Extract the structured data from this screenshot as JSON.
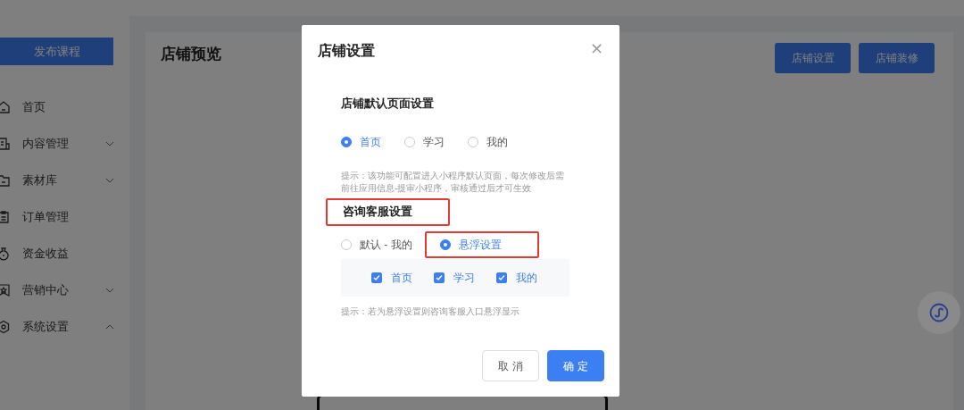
{
  "sidebar": {
    "publish_button": "发布课程",
    "items": [
      {
        "label": "首页",
        "expandable": false
      },
      {
        "label": "内容管理",
        "expandable": true,
        "expanded": false
      },
      {
        "label": "素材库",
        "expandable": true,
        "expanded": false
      },
      {
        "label": "订单管理",
        "expandable": false
      },
      {
        "label": "资金收益",
        "expandable": false
      },
      {
        "label": "营销中心",
        "expandable": true,
        "expanded": false
      },
      {
        "label": "系统设置",
        "expandable": true,
        "expanded": true
      }
    ]
  },
  "main": {
    "title": "店铺预览",
    "buttons": [
      "店铺设置",
      "店铺装修"
    ]
  },
  "modal": {
    "title": "店铺设置",
    "close": "×",
    "default_page": {
      "heading": "店铺默认页面设置",
      "options": [
        {
          "label": "首页",
          "selected": true
        },
        {
          "label": "学习",
          "selected": false
        },
        {
          "label": "我的",
          "selected": false
        }
      ],
      "hint": "提示：该功能可配置进入小程序默认页面，每次修改后需前往应用信息-提审小程序，审核通过后才可生效"
    },
    "consult": {
      "heading": "咨询客服设置",
      "heading_highlighted": true,
      "options": [
        {
          "label": "默认 - 我的",
          "selected": false,
          "highlighted": false
        },
        {
          "label": "悬浮设置",
          "selected": true,
          "highlighted": true
        }
      ],
      "pages": [
        {
          "label": "首页",
          "checked": true
        },
        {
          "label": "学习",
          "checked": true
        },
        {
          "label": "我的",
          "checked": true
        }
      ],
      "hint": "提示：若为悬浮设置则咨询客服入口悬浮显示"
    },
    "buttons": [
      {
        "label": "取 消",
        "kind": "secondary"
      },
      {
        "label": "确 定",
        "kind": "primary"
      }
    ]
  }
}
